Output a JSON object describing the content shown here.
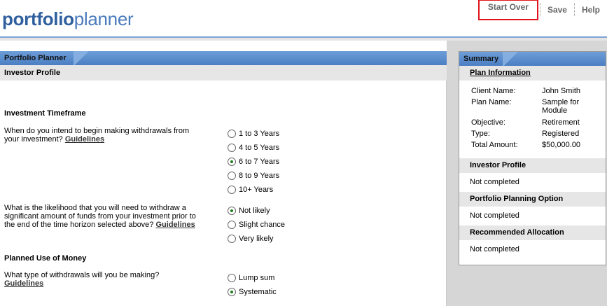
{
  "brand": {
    "part1": "portfolio",
    "part2": "planner"
  },
  "topnav": {
    "start_over": "Start Over",
    "save": "Save",
    "help": "Help"
  },
  "main": {
    "header": "Portfolio Planner",
    "subheader": "Investor Profile",
    "sections": [
      {
        "title": "Investment Timeframe",
        "question": "When do you intend to begin making withdrawals from your investment?",
        "guidelines": "Guidelines",
        "options": [
          "1 to 3 Years",
          "4 to 5 Years",
          "6 to 7 Years",
          "8 to 9 Years",
          "10+ Years"
        ],
        "selected": "6 to 7 Years"
      },
      {
        "title": "",
        "question": "What is the likelihood that you will need to withdraw a significant amount of funds from your investment prior to the end of the time horizon selected above?",
        "guidelines": "Guidelines",
        "options": [
          "Not likely",
          "Slight chance",
          "Very likely"
        ],
        "selected": "Not likely"
      },
      {
        "title": "Planned Use of Money",
        "question": "What type of withdrawals will you be making?",
        "guidelines": "Guidelines",
        "options": [
          "Lump sum",
          "Systematic"
        ],
        "selected": "Systematic"
      }
    ]
  },
  "summary": {
    "header": "Summary",
    "plan_info_label": "Plan Information",
    "plan_info": [
      {
        "key": "Client Name:",
        "value": "John Smith"
      },
      {
        "key": "Plan Name:",
        "value": "Sample for Module"
      },
      {
        "key": "Objective:",
        "value": "Retirement"
      },
      {
        "key": "Type:",
        "value": "Registered"
      },
      {
        "key": "Total Amount:",
        "value": "$50,000.00"
      }
    ],
    "investor_profile_label": "Investor Profile",
    "investor_profile_value": "Not completed",
    "planning_option_label": "Portfolio Planning Option",
    "planning_option_value": "Not completed",
    "allocation_label": "Recommended Allocation",
    "allocation_value": "Not completed"
  },
  "colors": {
    "accent_red": "#e0141c",
    "header_blue": "#5a8ccd",
    "logo_blue": "#2f5f9e",
    "radio_green": "#1a7d1a"
  }
}
